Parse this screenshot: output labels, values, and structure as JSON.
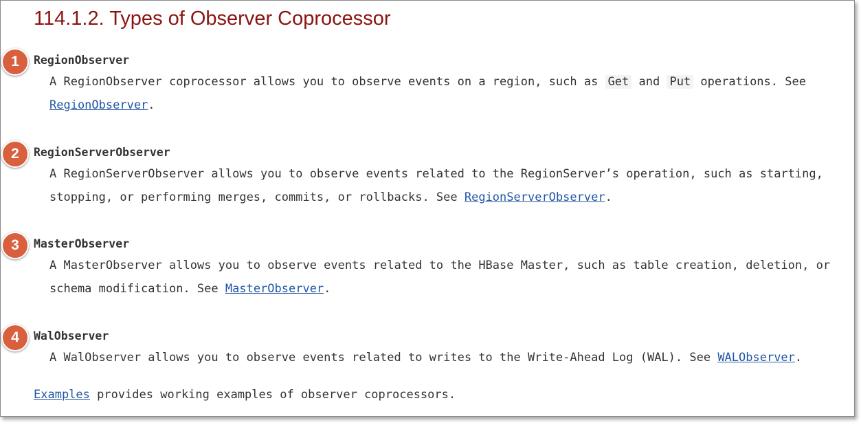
{
  "page": {
    "title": "114.1.2. Types of Observer Coprocessor"
  },
  "observers": [
    {
      "badge": "1",
      "term": "RegionObserver",
      "desc_l1_a": "A RegionObserver coprocessor allows you to observe events on a region, such as ",
      "code1": "Get",
      "desc_l1_b": " and ",
      "code2": "Put",
      "desc_l1_c": " operations. See",
      "link": "RegionObserver",
      "tail": "."
    },
    {
      "badge": "2",
      "term": "RegionServerObserver",
      "desc_l1": "A RegionServerObserver allows you to observe events related to the RegionServer’s operation, such as starting,",
      "desc_l2": "stopping, or performing merges, commits, or rollbacks. See ",
      "link": "RegionServerObserver",
      "tail": "."
    },
    {
      "badge": "3",
      "term": "MasterObserver",
      "desc_l1": "A MasterObserver allows you to observe events related to the HBase Master, such as table creation, deletion, or",
      "desc_l2": "schema modification. See ",
      "link": "MasterObserver",
      "tail": "."
    },
    {
      "badge": "4",
      "term": "WalObserver",
      "desc_l1": "A WalObserver allows you to observe events related to writes to the Write-Ahead Log (WAL). See ",
      "link": "WALObserver",
      "tail": "."
    }
  ],
  "footer": {
    "link": "Examples",
    "text": " provides working examples of observer coprocessors."
  },
  "colors": {
    "title": "#8b1410",
    "badge": "#d9603e",
    "link": "#2156a5",
    "text": "#333333"
  }
}
